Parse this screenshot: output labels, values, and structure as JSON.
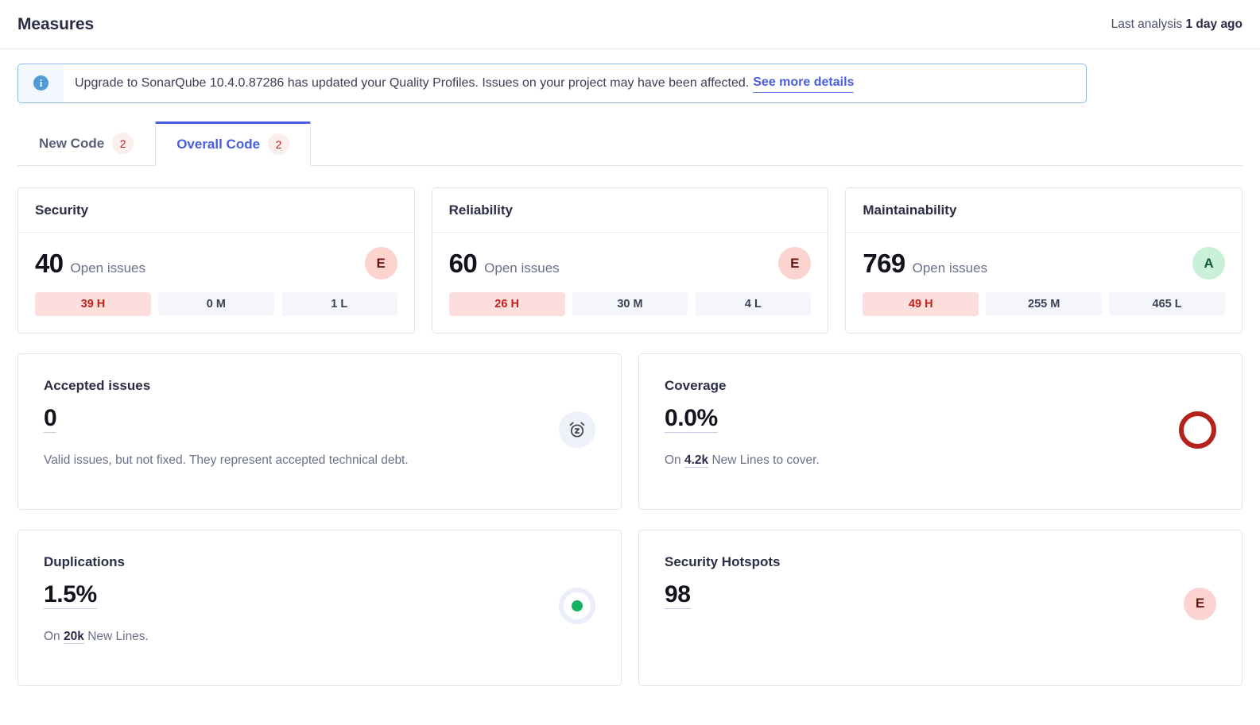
{
  "header": {
    "title": "Measures",
    "last_analysis_label": "Last analysis",
    "last_analysis_value": "1 day ago"
  },
  "banner": {
    "icon": "info-icon",
    "icon_glyph": "i",
    "message": "Upgrade to SonarQube 10.4.0.87286 has updated your Quality Profiles. Issues on your project may have been affected.",
    "link_label": "See more details",
    "border_color": "#8cb9e8",
    "link_color": "#4a5ddd"
  },
  "tabs": [
    {
      "label": "New Code",
      "badge": "2",
      "active": false
    },
    {
      "label": "Overall Code",
      "badge": "2",
      "active": true
    }
  ],
  "metric_cards": [
    {
      "title": "Security",
      "count": "40",
      "count_label": "Open issues",
      "rating": "E",
      "rating_color": "#fcd3ce",
      "severities": [
        {
          "label": "39 H",
          "level": "high"
        },
        {
          "label": "0 M",
          "level": "medium"
        },
        {
          "label": "1 L",
          "level": "low"
        }
      ]
    },
    {
      "title": "Reliability",
      "count": "60",
      "count_label": "Open issues",
      "rating": "E",
      "rating_color": "#fcd3ce",
      "severities": [
        {
          "label": "26 H",
          "level": "high"
        },
        {
          "label": "30 M",
          "level": "medium"
        },
        {
          "label": "4 L",
          "level": "low"
        }
      ]
    },
    {
      "title": "Maintainability",
      "count": "769",
      "count_label": "Open issues",
      "rating": "A",
      "rating_color": "#caf0d8",
      "severities": [
        {
          "label": "49 H",
          "level": "high"
        },
        {
          "label": "255 M",
          "level": "medium"
        },
        {
          "label": "465 L",
          "level": "low"
        }
      ]
    }
  ],
  "info_cards": {
    "accepted_issues": {
      "title": "Accepted issues",
      "value": "0",
      "description": "Valid issues, but not fixed. They represent accepted technical debt.",
      "indicator": "snoozed-alarm-clock-icon"
    },
    "coverage": {
      "title": "Coverage",
      "value": "0.0%",
      "sub_prefix": "On",
      "sub_value": "4.2k",
      "sub_suffix": "New Lines to cover.",
      "indicator": "coverage-ring",
      "indicator_color": "#b3231c"
    },
    "duplications": {
      "title": "Duplications",
      "value": "1.5%",
      "sub_prefix": "On",
      "sub_value": "20k",
      "sub_suffix": "New Lines.",
      "indicator": "duplications-ring",
      "indicator_color": "#16b364"
    },
    "security_hotspots": {
      "title": "Security Hotspots",
      "value": "98",
      "rating": "E",
      "rating_color": "#fcd3ce"
    }
  }
}
